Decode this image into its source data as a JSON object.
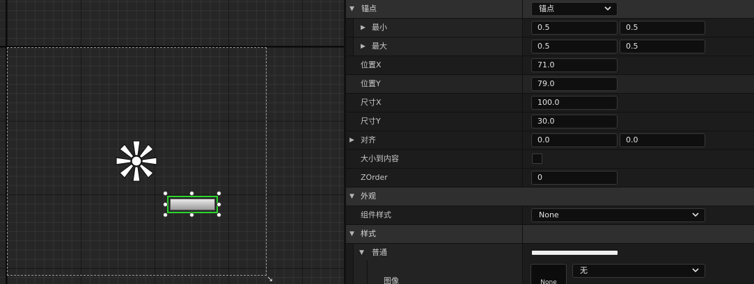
{
  "details": {
    "anchors": {
      "label": "锚点",
      "dropdown_value": "锚点"
    },
    "min": {
      "label": "最小",
      "x": "0.5",
      "y": "0.5"
    },
    "max": {
      "label": "最大",
      "x": "0.5",
      "y": "0.5"
    },
    "position_x": {
      "label": "位置X",
      "value": "71.0"
    },
    "position_y": {
      "label": "位置Y",
      "value": "79.0"
    },
    "size_x": {
      "label": "尺寸X",
      "value": "100.0"
    },
    "size_y": {
      "label": "尺寸Y",
      "value": "30.0"
    },
    "alignment": {
      "label": "对齐",
      "x": "0.0",
      "y": "0.0"
    },
    "size_to_content": {
      "label": "大小到内容",
      "checked": false
    },
    "zorder": {
      "label": "ZOrder",
      "value": "0"
    }
  },
  "appearance": {
    "label": "外观",
    "widget_style": {
      "label": "组件样式",
      "value": "None"
    }
  },
  "style": {
    "label": "样式",
    "normal": {
      "label": "普通",
      "tint_color": "#efefef"
    },
    "image": {
      "label": "图像",
      "thumb_text": "None",
      "dropdown_value": "无"
    }
  },
  "colors": {
    "selection": "#2bd62b",
    "panel_bg": "#1a1a1a",
    "category_bg": "#2f2f2f",
    "field_bg": "#0f0f0f"
  },
  "icons": [
    "expand-arrow-icon",
    "collapse-arrow-icon",
    "chevron-down-icon",
    "sun-light-icon",
    "resize-corner-icon"
  ]
}
